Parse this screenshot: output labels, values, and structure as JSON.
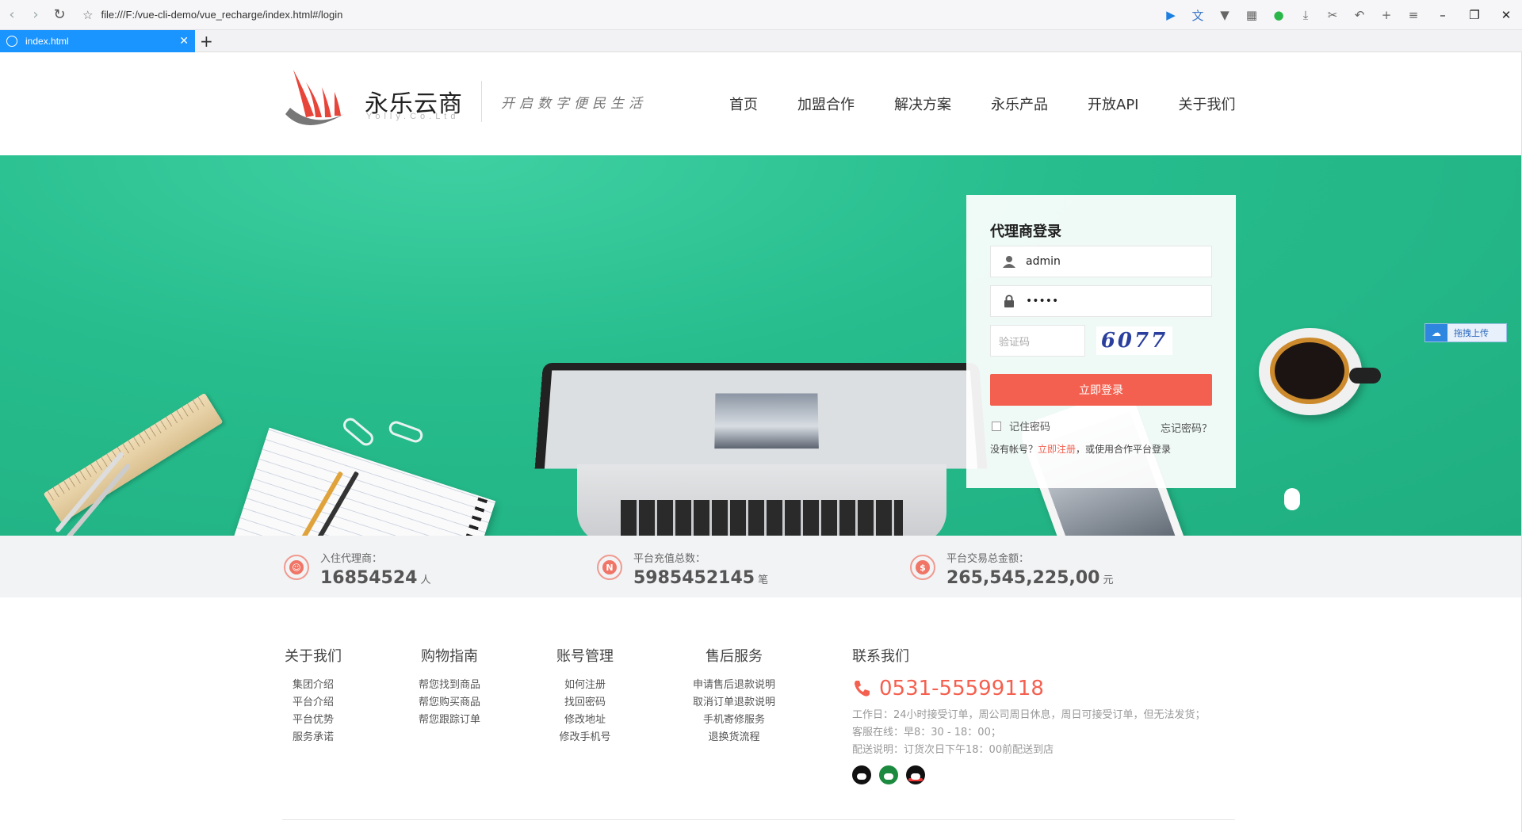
{
  "browser": {
    "address": "file:///F:/vue-cli-demo/vue_recharge/index.html#/login",
    "tab_title": "index.html"
  },
  "header": {
    "logo_title": "永乐云商",
    "logo_sub": "Yolly.Co.Ltd",
    "slogan": "开启数字便民生活",
    "nav": [
      "首页",
      "加盟合作",
      "解决方案",
      "永乐产品",
      "开放API",
      "关于我们"
    ]
  },
  "login": {
    "title": "代理商登录",
    "username": "admin",
    "password_mask": "•••••",
    "captcha_placeholder": "验证码",
    "captcha_text": "6077",
    "submit": "立即登录",
    "remember": "记住密码",
    "forgot": "忘记密码？",
    "register_prefix": "没有帐号？",
    "register_link": "立即注册",
    "register_suffix": "，或使用合作平台登录"
  },
  "drag_upload": "拖拽上传",
  "stats": [
    {
      "label": "入住代理商：",
      "value": "16854524",
      "unit": "人",
      "icon": "user-icon"
    },
    {
      "label": "平台充值总数：",
      "value": "5985452145",
      "unit": "笔",
      "icon": "recharge-icon"
    },
    {
      "label": "平台交易总金额：",
      "value": "265,545,225,00",
      "unit": "元",
      "icon": "money-icon"
    }
  ],
  "footer": {
    "columns": [
      {
        "title": "关于我们",
        "items": [
          "集团介绍",
          "平台介绍",
          "平台优势",
          "服务承诺"
        ]
      },
      {
        "title": "购物指南",
        "items": [
          "帮您找到商品",
          "帮您购买商品",
          "帮您跟踪订单"
        ]
      },
      {
        "title": "账号管理",
        "items": [
          "如何注册",
          "找回密码",
          "修改地址",
          "修改手机号"
        ]
      },
      {
        "title": "售后服务",
        "items": [
          "申请售后退款说明",
          "取消订单退款说明",
          "手机寄修服务",
          "退换货流程"
        ]
      }
    ],
    "contact": {
      "title": "联系我们",
      "phone": "0531-55599118",
      "lines": [
        "工作日：24小时接受订单，周公司周日休息，周日可接受订单，但无法发货；",
        "客服在线：早8：30 - 18：00；",
        "配送说明：订货次日下午18：00前配送到店"
      ]
    }
  },
  "colors": {
    "accent": "#f4604f",
    "hero": "#27bd8d"
  }
}
